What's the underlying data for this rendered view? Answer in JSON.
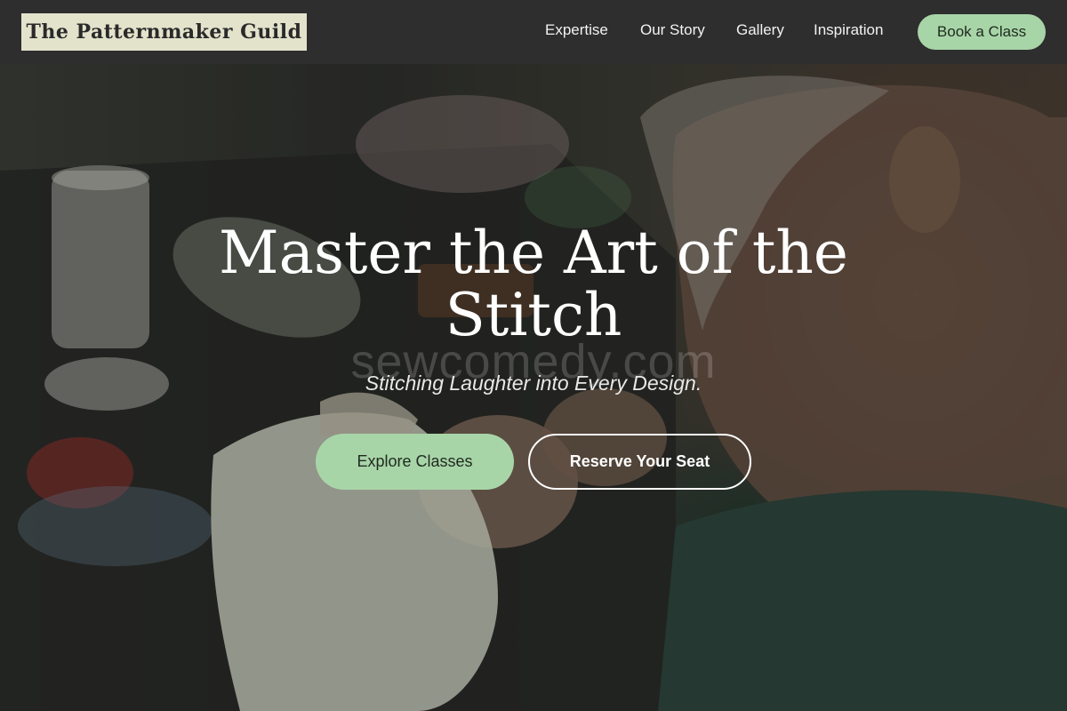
{
  "header": {
    "logo": "The Patternmaker Guild",
    "nav": [
      "Expertise",
      "Our Story",
      "Gallery",
      "Inspiration"
    ],
    "cta": "Book a Class"
  },
  "hero": {
    "title": "Master the Art of the Stitch",
    "watermark": "sewcomedy.com",
    "tagline": "Stitching Laughter into Every Design.",
    "primary_button": "Explore Classes",
    "secondary_button": "Reserve Your Seat"
  },
  "colors": {
    "header_bg": "#2e2e2e",
    "logo_bg": "#e3e3cc",
    "accent_green": "#a8d5a8",
    "text_light": "#ffffff"
  }
}
